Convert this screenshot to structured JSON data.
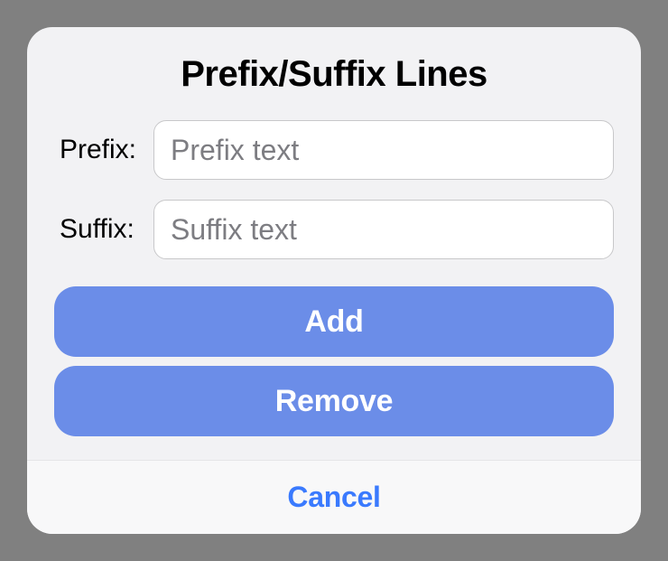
{
  "dialog": {
    "title": "Prefix/Suffix Lines",
    "fields": {
      "prefix": {
        "label": "Prefix:",
        "placeholder": "Prefix text",
        "value": ""
      },
      "suffix": {
        "label": "Suffix:",
        "placeholder": "Suffix text",
        "value": ""
      }
    },
    "buttons": {
      "add": "Add",
      "remove": "Remove",
      "cancel": "Cancel"
    }
  }
}
